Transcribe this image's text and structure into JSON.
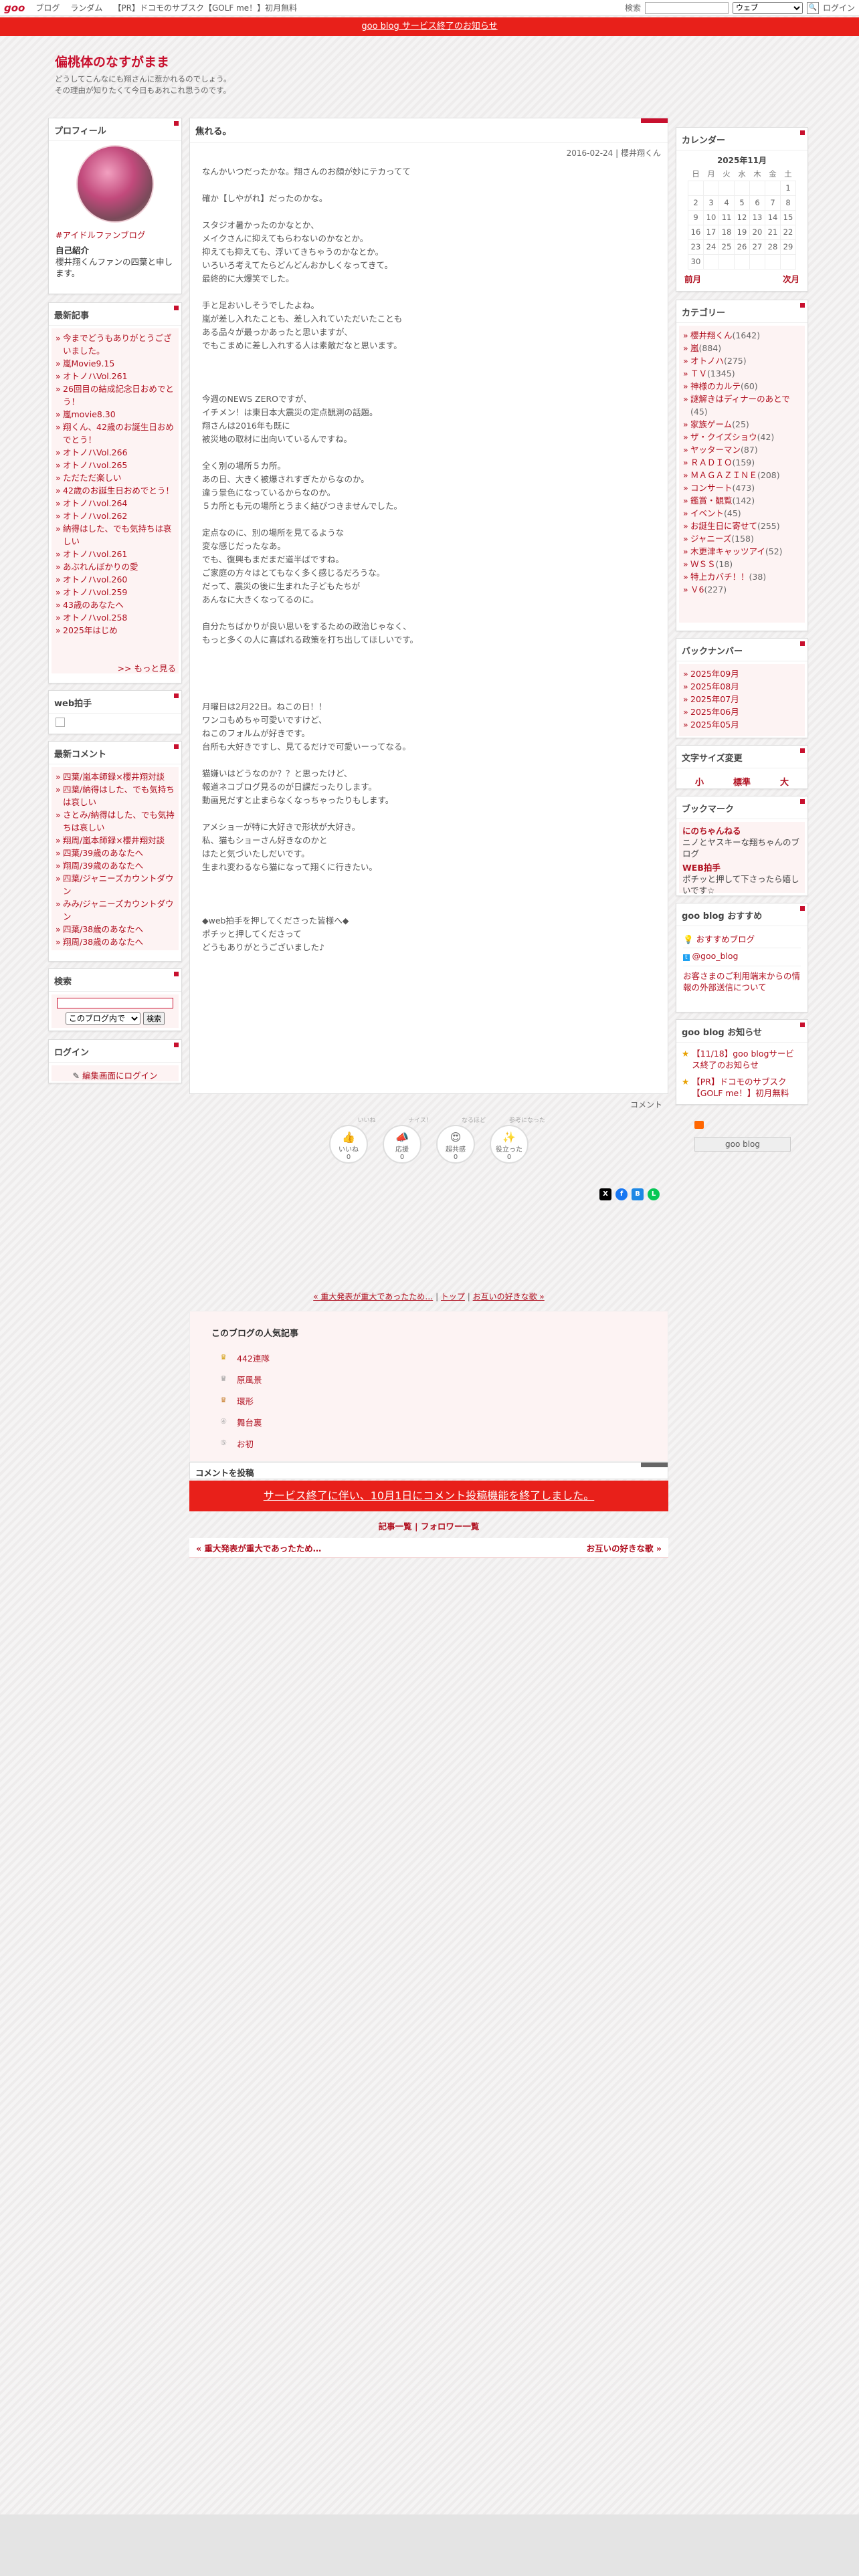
{
  "topbar": {
    "logo": "goo",
    "links": [
      "ブログ",
      "ランダム",
      "【PR】ドコモのサブスク【GOLF me！】初月無料"
    ],
    "search_label": "検索",
    "search_value": "",
    "select_value": "ウェブ",
    "login": "ログイン"
  },
  "notice": "goo blog サービス終了のお知らせ",
  "blog": {
    "title": "偏桃体のなすがまま",
    "desc": [
      "どうしてこんなにも翔さんに惹かれるのでしょう。",
      "その理由が知りたくて今日もあれこれ思うのです。"
    ]
  },
  "profile": {
    "title": "プロフィール",
    "link": "#アイドルファンブログ",
    "intro_label": "自己紹介",
    "intro": "櫻井翔くんファンの四葉と申します。"
  },
  "recent": {
    "title": "最新記事",
    "items": [
      "今までどうもありがとうございました。",
      "嵐Movie9.15",
      "オトノハVol.261",
      "26回目の結成記念日おめでとう！",
      "嵐movie8.30",
      "翔くん、42歳のお誕生日おめでとう！",
      "オトノハVol.266",
      "オトノハvol.265",
      "ただただ楽しい",
      "42歳のお誕生日おめでとう！",
      "オトノハvol.264",
      "オトノハvol.262",
      "納得はした、でも気持ちは哀しい",
      "オトノハvol.261",
      "あぶれんぼかりの愛",
      "オトノハvol.260",
      "オトノハvol.259",
      "43歳のあなたへ",
      "オトノハvol.258",
      "2025年はじめ"
    ],
    "more": ">> もっと見る"
  },
  "webclap": {
    "title": "web拍手"
  },
  "comments": {
    "title": "最新コメント",
    "items": [
      "四葉/嵐本師録×櫻井翔対談",
      "四葉/納得はした、でも気持ちは哀しい",
      "さとみ/納得はした、でも気持ちは哀しい",
      "翔周/嵐本師録×櫻井翔対談",
      "四葉/39歳のあなたへ",
      "翔周/39歳のあなたへ",
      "四葉/ジャニーズカウントダウン",
      "みみ/ジャニーズカウントダウン",
      "四葉/38歳のあなたへ",
      "翔周/38歳のあなたへ"
    ]
  },
  "search": {
    "title": "検索",
    "scope": "このブログ内で",
    "button": "検索"
  },
  "login": {
    "title": "ログイン",
    "link": "編集画面にログイン"
  },
  "calendar": {
    "title": "カレンダー",
    "month": "2025年11月",
    "days": [
      "日",
      "月",
      "火",
      "水",
      "木",
      "金",
      "土"
    ],
    "weeks": [
      [
        "",
        "",
        "",
        "",
        "",
        "",
        "1"
      ],
      [
        "2",
        "3",
        "4",
        "5",
        "6",
        "7",
        "8"
      ],
      [
        "9",
        "10",
        "11",
        "12",
        "13",
        "14",
        "15"
      ],
      [
        "16",
        "17",
        "18",
        "19",
        "20",
        "21",
        "22"
      ],
      [
        "23",
        "24",
        "25",
        "26",
        "27",
        "28",
        "29"
      ],
      [
        "30",
        "",
        "",
        "",
        "",
        "",
        ""
      ]
    ],
    "prev": "前月",
    "next": "次月"
  },
  "categories": {
    "title": "カテゴリー",
    "items": [
      [
        "櫻井翔くん",
        "(1642)"
      ],
      [
        "嵐",
        "(884)"
      ],
      [
        "オトノハ",
        "(275)"
      ],
      [
        "ＴＶ",
        "(1345)"
      ],
      [
        "神様のカルテ",
        "(60)"
      ],
      [
        "謎解きはディナーのあとで",
        "(45)"
      ],
      [
        "家族ゲーム",
        "(25)"
      ],
      [
        "ザ・クイズショウ",
        "(42)"
      ],
      [
        "ヤッターマン",
        "(87)"
      ],
      [
        "ＲＡＤＩＯ",
        "(159)"
      ],
      [
        "ＭＡＧＡＺＩＮＥ",
        "(208)"
      ],
      [
        "コンサート",
        "(473)"
      ],
      [
        "鑑賞・観覧",
        "(142)"
      ],
      [
        "イベント",
        "(45)"
      ],
      [
        "お誕生日に寄せて",
        "(255)"
      ],
      [
        "ジャニーズ",
        "(158)"
      ],
      [
        "木更津キャッツアイ",
        "(52)"
      ],
      [
        "ＷＳＳ",
        "(18)"
      ],
      [
        "特上カバチ！！",
        "(38)"
      ],
      [
        "Ｖ6",
        "(227)"
      ]
    ]
  },
  "backnumber": {
    "title": "バックナンバー",
    "items": [
      "2025年09月",
      "2025年08月",
      "2025年07月",
      "2025年06月",
      "2025年05月"
    ]
  },
  "fontsize": {
    "title": "文字サイズ変更",
    "sizes": [
      "小",
      "標準",
      "大"
    ]
  },
  "bookmark": {
    "title": "ブックマーク",
    "items": [
      {
        "name": "にのちゃんねる",
        "desc": "ニノとヤスキーな翔ちゃんのブログ"
      },
      {
        "name": "WEB拍手",
        "desc": "ポチッと押して下さったら嬉しいです☆"
      }
    ]
  },
  "recommend": {
    "title": "goo blog おすすめ",
    "items": [
      "おすすめブログ",
      "@goo_blog"
    ],
    "note": "お客さまのご利用端末からの情報の外部送信について"
  },
  "gnotice": {
    "title": "goo blog お知らせ",
    "items": [
      "【11/18】goo blogサービス終了のお知らせ",
      "【PR】ドコモのサブスク【GOLF me！】初月無料"
    ]
  },
  "footer_logo": "goo blog",
  "post": {
    "title": "焦れる。",
    "meta": "2016-02-24 | 櫻井翔くん",
    "body": "なんかいつだったかな。翔さんのお顔が妙にテカってて\n\n確か【しやがれ】だったのかな。\n\nスタジオ暑かったのかなとか、\nメイクさんに抑えてもらわないのかなとか。\n抑えても抑えても、浮いてきちゃうのかなとか。\nいろいろ考えてたらどんどんおかしくなってきて。\n最終的に大爆笑でした。\n\n手と足おいしそうでしたよね。\n嵐が差し入れたことも、差し入れていただいたことも\nある品々が最っかあったと思いますが、\nでもこまめに差し入れする人は素敵だなと思います。\n\n\n\n今週のNEWS ZEROですが、\nイチメン！は東日本大震災の定点観測の話題。\n翔さんは2016年も既に\n被災地の取材に出向いているんですね。\n\n全く別の場所５カ所。\nあの日、大きく被爆されすぎたからなのか。\n違う景色になっているからなのか。\n５カ所とも元の場所とうまく結びつきませんでした。\n\n定点なのに、別の場所を見てるような\n変な感じだったなあ。\nでも、復興もまだまだ道半ばですね。\nご家庭の方々はとてもなく多く感じるだろうな。\nだって、震災の後に生まれた子どもたちが\nあんなに大きくなってるのに。\n\n自分たちばかりが良い思いをするための政治じゃなく、\nもっと多くの人に喜ばれる政策を打ち出してほしいです。\n\n\n\n\n月曜日は2月22日。ねこの日！！\nワンコもめちゃ可愛いですけど、\nねこのフォルムが好きです。\n台所も大好きですし、見てるだけで可愛いーってなる。\n\n猫嫌いはどうなのか？？と思ったけど、\n報道ネコブログ見るのが日課だったりします。\n動画見だすと止まらなくなっちゃったりもします。\n\nアメショーが特に大好きで形状が大好き。\n私、猫もショーさん好きなのかと\nはたと気づいたしだいです。\n生まれ変わるなら猫になって翔くに行きたい。\n\n\n\n◆web拍手を押してくださった皆様へ◆\nポチッと押してくださって\nどうもありがとうございました♪",
    "comment_link": "コメント",
    "reactions": [
      {
        "top": "いいね",
        "label": "いいね",
        "count": "0"
      },
      {
        "top": "ナイス！",
        "label": "応援",
        "count": "0"
      },
      {
        "top": "なるほど",
        "label": "超共感",
        "count": "0"
      },
      {
        "top": "参考になった",
        "label": "役立った",
        "count": "0"
      }
    ]
  },
  "nav": {
    "prev": "« 重大発表が重大であったため…",
    "mid1": "トップ",
    "mid2": "お互いの好きな歌 »"
  },
  "popular": {
    "title": "このブログの人気記事",
    "items": [
      "442連隊",
      "原風景",
      "環形",
      "舞台裏",
      "お初"
    ]
  },
  "comment_post": {
    "title": "コメントを投稿",
    "closed": "サービス終了に伴い、10月1日にコメント投稿機能を終了しました。"
  },
  "links": {
    "list": "記事一覧",
    "follow": "フォロワー一覧"
  },
  "prevnext": {
    "prev": "« 重大発表が重大であったため…",
    "next": "お互いの好きな歌 »"
  }
}
